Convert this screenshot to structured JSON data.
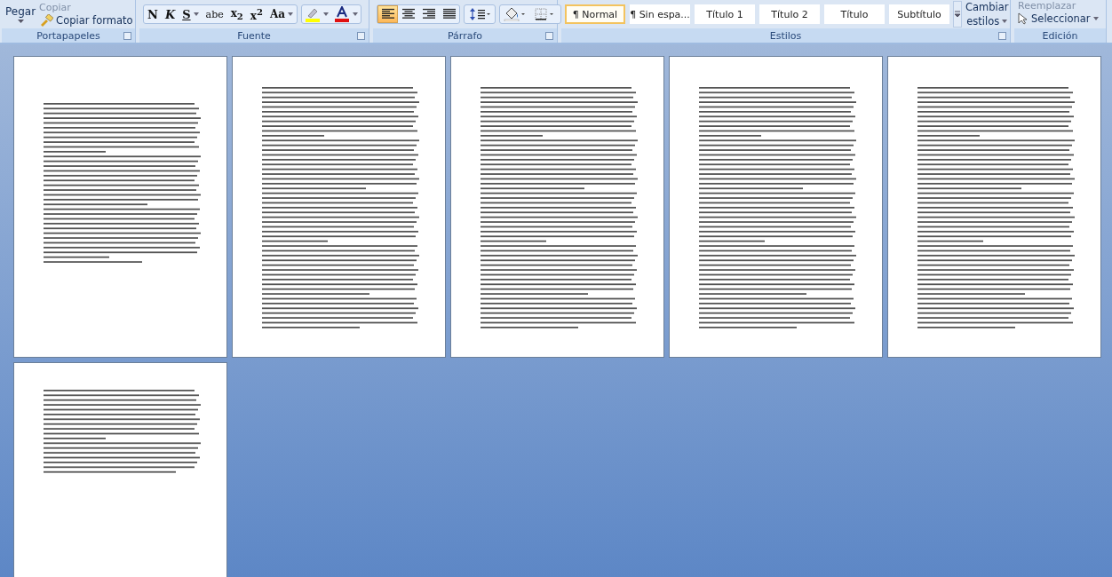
{
  "ribbon": {
    "clipboard": {
      "paste": "Pegar",
      "copy": "Copiar",
      "format_painter": "Copiar formato",
      "group_label": "Portapapeles"
    },
    "font": {
      "buttons": [
        {
          "label": "N",
          "kind": "bold",
          "dropdown": false
        },
        {
          "label": "K",
          "kind": "italic",
          "dropdown": false
        },
        {
          "label": "S",
          "kind": "underline",
          "dropdown": true
        },
        {
          "label": "abe",
          "kind": "strike",
          "dropdown": false
        },
        {
          "label": "x$_{2}$",
          "kind": "sub",
          "dropdown": false
        },
        {
          "label": "x$^{2}$",
          "kind": "sup",
          "dropdown": false
        },
        {
          "label": "Aa",
          "kind": "case",
          "dropdown": true
        }
      ],
      "colors": [
        {
          "kind": "highlight",
          "color": "#ffff00"
        },
        {
          "kind": "font-color",
          "color": "#e01010"
        }
      ],
      "group_label": "Fuente"
    },
    "paragraph": {
      "align": [
        {
          "kind": "left",
          "selected": true
        },
        {
          "kind": "center",
          "selected": false
        },
        {
          "kind": "right",
          "selected": false
        },
        {
          "kind": "justify",
          "selected": false
        }
      ],
      "group_label": "Párrafo"
    },
    "styles": {
      "items": [
        {
          "label": "¶ Normal",
          "selected": true
        },
        {
          "label": "¶ Sin espa...",
          "selected": false
        },
        {
          "label": "Título 1",
          "selected": false
        },
        {
          "label": "Título 2",
          "selected": false
        },
        {
          "label": "Título",
          "selected": false
        },
        {
          "label": "Subtítulo",
          "selected": false
        }
      ],
      "change_styles": [
        "Cambiar",
        "estilos"
      ],
      "group_label": "Estilos"
    },
    "editing": {
      "replace": "Reemplazar",
      "select": "Seleccionar",
      "group_label": "Edición"
    }
  },
  "pages": [
    {
      "kind": "partial"
    },
    {
      "kind": "full"
    },
    {
      "kind": "full"
    },
    {
      "kind": "full"
    },
    {
      "kind": "full"
    },
    {
      "kind": "short"
    }
  ]
}
